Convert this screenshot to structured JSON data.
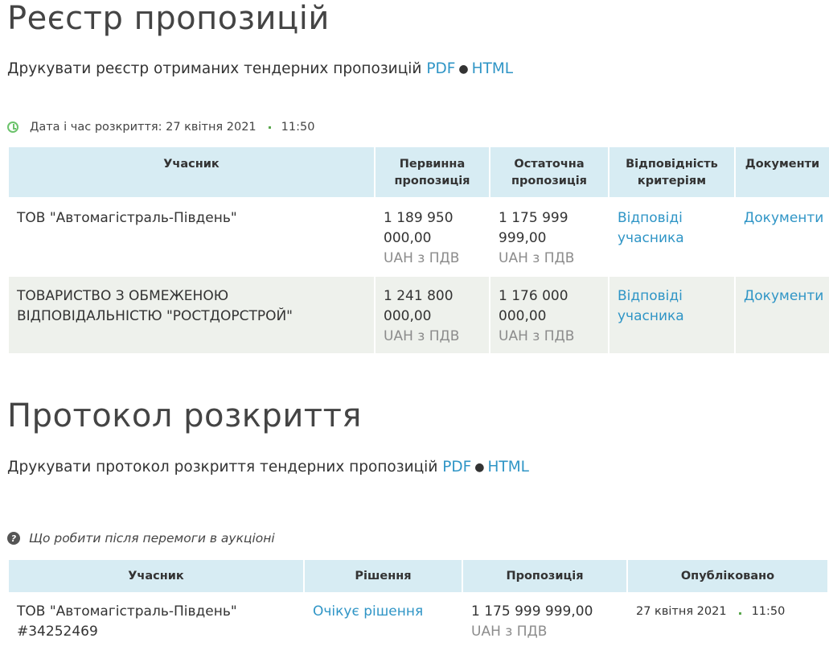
{
  "registry": {
    "title": "Реєстр пропозицій",
    "print_text": "Друкувати реєстр отриманих тендерних пропозицій",
    "pdf": "PDF",
    "sep": "●",
    "html": "HTML",
    "opening_label": "Дата і час розкриття: 27 квітня 2021",
    "opening_time": "11:50",
    "headers": {
      "participant": "Учасник",
      "initial": "Первинна пропозиція",
      "final": "Остаточна пропозиція",
      "criteria": "Відповідність критеріям",
      "docs": "Документи"
    },
    "rows": [
      {
        "name": "ТОВ \"Автомагістраль-Південь\"",
        "initial": "1 189 950 000,00",
        "initial_vat": "UAH з ПДВ",
        "final": "1 175 999 999,00",
        "final_vat": "UAH з ПДВ",
        "answers": "Відповіді учасника",
        "docs": "Документи"
      },
      {
        "name": "ТОВАРИСТВО З ОБМЕЖЕНОЮ ВІДПОВІДАЛЬНІСТЮ \"РОСТДОРСТРОЙ\"",
        "initial": "1 241 800 000,00",
        "initial_vat": "UAH з ПДВ",
        "final": "1 176 000 000,00",
        "final_vat": "UAH з ПДВ",
        "answers": "Відповіді учасника",
        "docs": "Документи"
      }
    ]
  },
  "protocol": {
    "title": "Протокол розкриття",
    "print_text": "Друкувати протокол розкриття тендерних пропозицій",
    "pdf": "PDF",
    "sep": "●",
    "html": "HTML",
    "hint": "Що робити після перемоги в аукціоні",
    "hint_icon": "question-circle-icon",
    "headers": {
      "participant": "Учасник",
      "decision": "Рішення",
      "offer": "Пропозиція",
      "published": "Опубліковано"
    },
    "rows": [
      {
        "name": "ТОВ \"Автомагістраль-Південь\"",
        "code": "#34252469",
        "decision": "Очікує рішення",
        "offer": "1 175 999 999,00",
        "offer_vat": "UAH з ПДВ",
        "pub_date": "27 квітня 2021",
        "pub_time": "11:50"
      }
    ]
  },
  "colors": {
    "link": "#2f95c6",
    "header_bg": "#d7ecf3",
    "alt_row_bg": "#eef1ec",
    "accent_green": "#6cc36c"
  }
}
